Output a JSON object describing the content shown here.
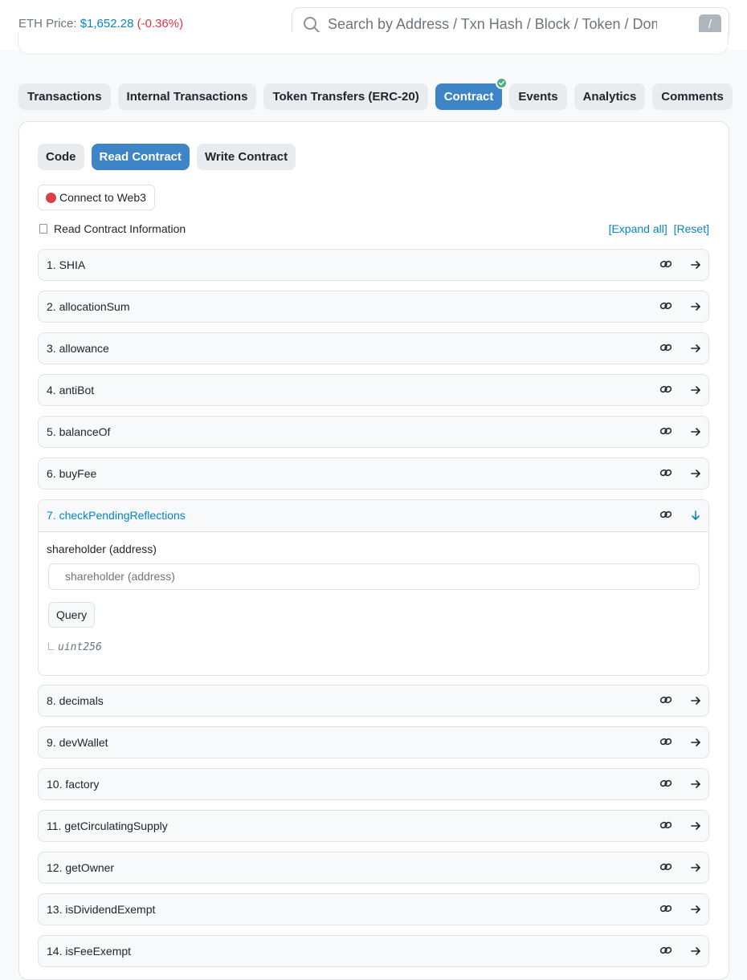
{
  "header": {
    "eth_price_label": "ETH Price:",
    "eth_price_value": "$1,652.28",
    "eth_price_change": "(-0.36%)",
    "search_placeholder": "Search by Address / Txn Hash / Block / Token / Domain Name",
    "search_shortcut": "/"
  },
  "tabs": [
    "Transactions",
    "Internal Transactions",
    "Token Transfers (ERC-20)",
    "Contract",
    "Events",
    "Analytics",
    "Comments"
  ],
  "subtabs": [
    "Code",
    "Read Contract",
    "Write Contract"
  ],
  "connect_label": "Connect to Web3",
  "info_label": "Read Contract Information",
  "expand_all": "[Expand all]",
  "reset": "[Reset]",
  "functions": [
    "1. SHIA",
    "2. allocationSum",
    "3. allowance",
    "4. antiBot",
    "5. balanceOf",
    "6. buyFee",
    "7. checkPendingReflections",
    "8. decimals",
    "9. devWallet",
    "10. factory",
    "11. getCirculatingSupply",
    "12. getOwner",
    "13. isDividendExempt",
    "14. isFeeExempt"
  ],
  "expanded": {
    "param_label": "shareholder (address)",
    "param_placeholder": "shareholder (address)",
    "query_label": "Query",
    "return_type": "uint256"
  },
  "colors": {
    "accent": "#3d85c6",
    "link": "#0784c3",
    "negative": "#dc3545",
    "verified": "#4caf7d"
  }
}
